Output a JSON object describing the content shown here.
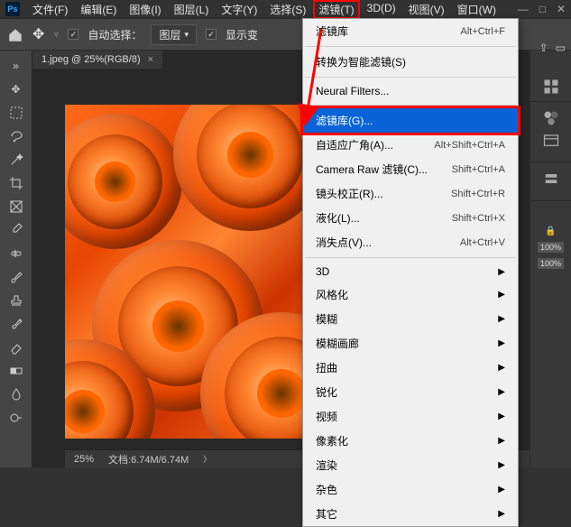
{
  "app": {
    "logo": "Ps"
  },
  "menubar": [
    "文件(F)",
    "编辑(E)",
    "图像(I)",
    "图层(L)",
    "文字(Y)",
    "选择(S)",
    "滤镜(T)",
    "3D(D)",
    "视图(V)",
    "窗口(W)"
  ],
  "active_menu_index": 6,
  "options": {
    "auto_select_label": "自动选择：",
    "dropdown_value": "图层",
    "show_transform_label": "显示变"
  },
  "document": {
    "tab_title": "1.jpeg @ 25%(RGB/8)",
    "zoom": "25%",
    "status": "文档:6.74M/6.74M"
  },
  "filter_menu": {
    "sections": [
      [
        {
          "label": "滤镜库",
          "shortcut": "Alt+Ctrl+F"
        }
      ],
      [
        {
          "label": "转换为智能滤镜(S)"
        }
      ],
      [
        {
          "label": "Neural Filters..."
        }
      ],
      [
        {
          "label": "滤镜库(G)...",
          "highlighted": true
        },
        {
          "label": "自适应广角(A)...",
          "shortcut": "Alt+Shift+Ctrl+A"
        },
        {
          "label": "Camera Raw 滤镜(C)...",
          "shortcut": "Shift+Ctrl+A"
        },
        {
          "label": "镜头校正(R)...",
          "shortcut": "Shift+Ctrl+R"
        },
        {
          "label": "液化(L)...",
          "shortcut": "Shift+Ctrl+X"
        },
        {
          "label": "消失点(V)...",
          "shortcut": "Alt+Ctrl+V"
        }
      ],
      [
        {
          "label": "3D",
          "submenu": true
        },
        {
          "label": "风格化",
          "submenu": true
        },
        {
          "label": "模糊",
          "submenu": true
        },
        {
          "label": "模糊画廊",
          "submenu": true
        },
        {
          "label": "扭曲",
          "submenu": true
        },
        {
          "label": "锐化",
          "submenu": true
        },
        {
          "label": "视频",
          "submenu": true
        },
        {
          "label": "像素化",
          "submenu": true
        },
        {
          "label": "渲染",
          "submenu": true
        },
        {
          "label": "杂色",
          "submenu": true
        },
        {
          "label": "其它",
          "submenu": true
        }
      ]
    ]
  },
  "right_panel": {
    "pct1": "100%",
    "pct2": "100%"
  }
}
